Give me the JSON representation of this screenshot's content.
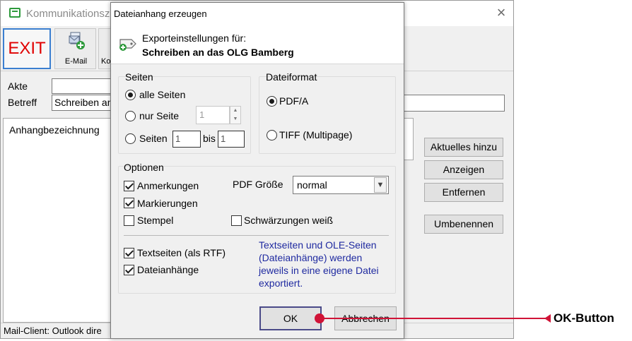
{
  "main_window": {
    "title": "Kommunikationsze",
    "close_glyph": "×",
    "toolbar": {
      "exit_label": "EXIT",
      "email_label": "E-Mail",
      "kom_label": "Kom"
    },
    "akte_label": "Akte",
    "betreff_label": "Betreff",
    "betreff_value": "Schreiben an",
    "attach_header": "Anhangbezeichnung",
    "buttons": {
      "aktuelles": "Aktuelles hinzu",
      "anzeigen": "Anzeigen",
      "entfernen": "Entfernen",
      "umbenennen": "Umbenennen"
    },
    "status": "Mail-Client: Outlook dire"
  },
  "dialog": {
    "title": "Dateianhang erzeugen",
    "export_label": "Exporteinstellungen für:",
    "export_doc": "Schreiben an das OLG Bamberg",
    "seiten": {
      "title": "Seiten",
      "alle": "alle Seiten",
      "nur": "nur Seite",
      "nur_value": "1",
      "seiten": "Seiten",
      "from_value": "1",
      "bis": "bis",
      "to_value": "1",
      "selected": "alle"
    },
    "dateiformat": {
      "title": "Dateiformat",
      "pdfa": "PDF/A",
      "tiff": "TIFF (Multipage)",
      "selected": "pdfa"
    },
    "optionen": {
      "title": "Optionen",
      "anmerkungen": "Anmerkungen",
      "markierungen": "Markierungen",
      "stempel": "Stempel",
      "schwaerzungen": "Schwärzungen weiß",
      "pdf_groesse_label": "PDF Größe",
      "pdf_groesse_value": "normal",
      "textseiten": "Textseiten (als RTF)",
      "dateianhaenge": "Dateianhänge",
      "info": "Textseiten und OLE-Seiten (Dateianhänge) werden jeweils in eine eigene Datei exportiert.",
      "checked": {
        "anmerkungen": true,
        "markierungen": true,
        "stempel": false,
        "schwaerzungen": false,
        "textseiten": true,
        "dateianhaenge": true
      }
    },
    "ok_label": "OK",
    "cancel_label": "Abbrechen"
  },
  "callout": {
    "label": "OK-Button",
    "color": "#d01437"
  },
  "colors": {
    "exit_text": "#e00000",
    "info_text": "#1f2aa0",
    "app_icon": "#2e9a3c"
  },
  "icons": {
    "app": "app-window-icon",
    "email": "email-add-icon",
    "export": "export-tag-icon",
    "close": "close-icon",
    "dropdown": "chevron-down-icon"
  }
}
